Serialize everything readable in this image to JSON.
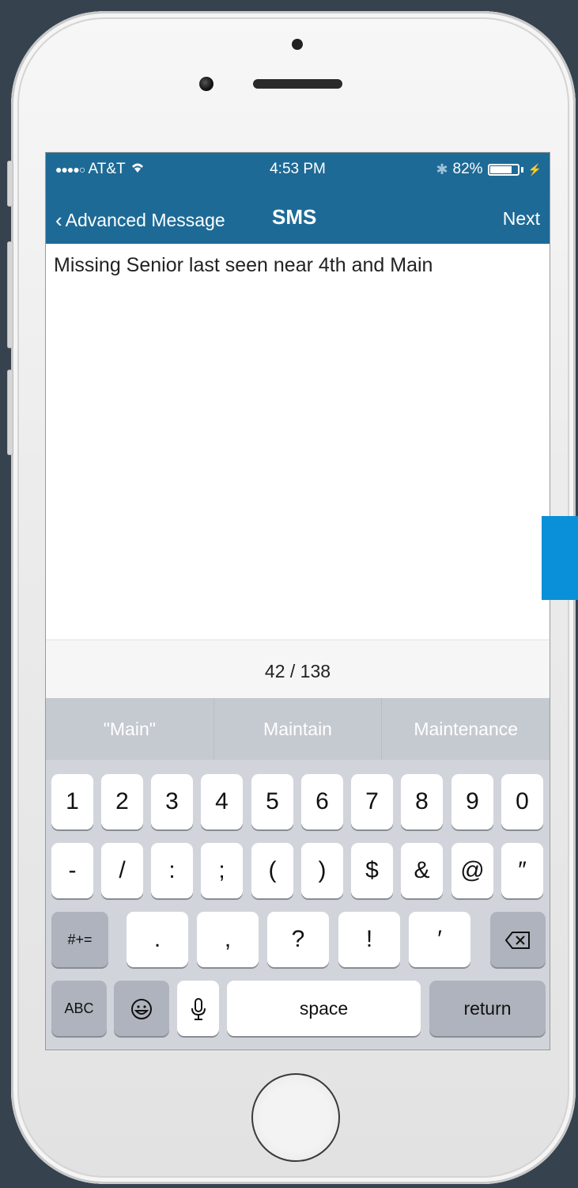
{
  "status": {
    "carrier": "AT&T",
    "time": "4:53 PM",
    "battery": "82%"
  },
  "nav": {
    "back_label": "Advanced Message",
    "title": "SMS",
    "next_label": "Next"
  },
  "message": {
    "text": "Missing Senior last seen near 4th and Main"
  },
  "counter": {
    "text": "42 / 138"
  },
  "suggestions": [
    "\"Main\"",
    "Maintain",
    "Maintenance"
  ],
  "keyboard": {
    "row1": [
      "1",
      "2",
      "3",
      "4",
      "5",
      "6",
      "7",
      "8",
      "9",
      "0"
    ],
    "row2": [
      "-",
      "/",
      ":",
      ";",
      "(",
      ")",
      "$",
      "&",
      "@",
      "″"
    ],
    "row3": [
      "#+=",
      ".",
      ",",
      "?",
      "!",
      "′"
    ],
    "row4": {
      "abc": "ABC",
      "space": "space",
      "return": "return"
    }
  },
  "colors": {
    "navbar": "#1e6a96",
    "side_tab": "#0a90d8"
  }
}
